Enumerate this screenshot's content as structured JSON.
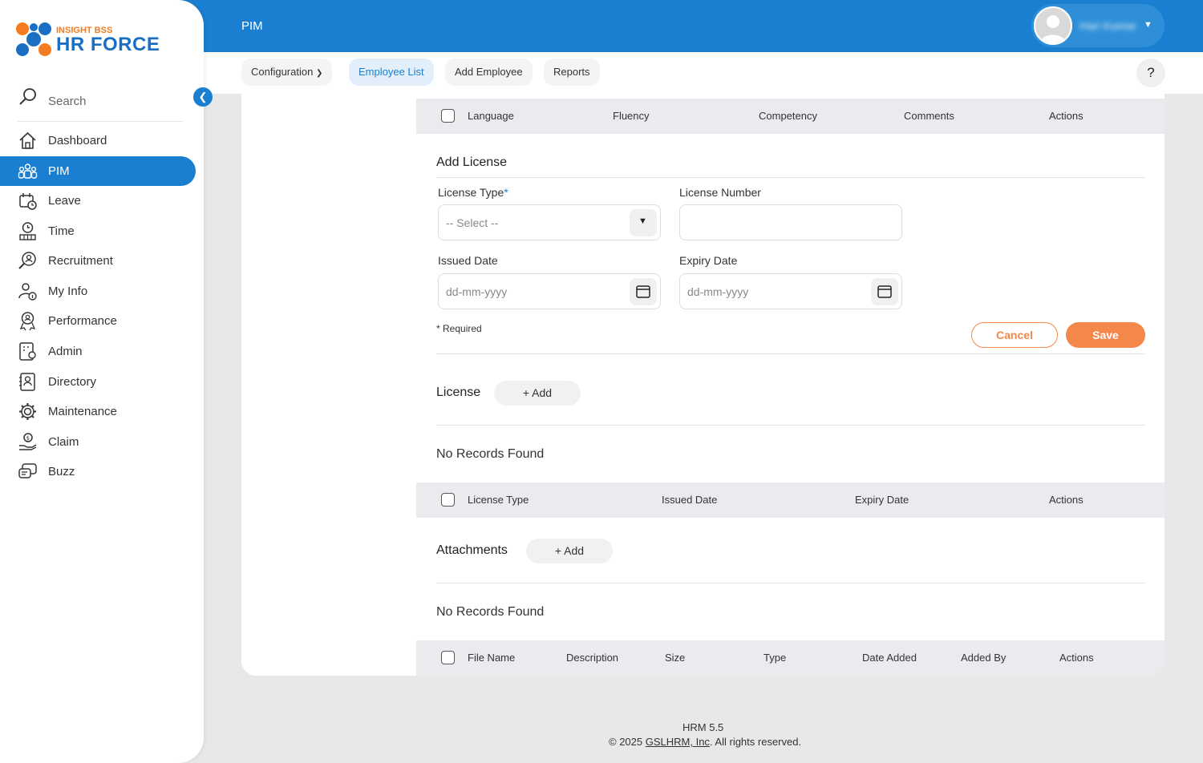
{
  "app": {
    "logo_small": "INSIGHT BSS",
    "logo_big": "HR FORCE",
    "module_title": "PIM",
    "user_name": "Hari Kumar",
    "colors": {
      "primary": "#1a7fd0",
      "accent": "#f4884a",
      "logo_orange": "#f47b20",
      "logo_blue": "#1a6fc4"
    }
  },
  "sidebar": {
    "search_label": "Search",
    "items": [
      {
        "label": "Dashboard",
        "icon": "home-icon"
      },
      {
        "label": "PIM",
        "icon": "people-icon",
        "active": true
      },
      {
        "label": "Leave",
        "icon": "leave-icon"
      },
      {
        "label": "Time",
        "icon": "clock-icon"
      },
      {
        "label": "Recruitment",
        "icon": "recruitment-icon"
      },
      {
        "label": "My Info",
        "icon": "user-info-icon"
      },
      {
        "label": "Performance",
        "icon": "award-icon"
      },
      {
        "label": "Admin",
        "icon": "admin-icon"
      },
      {
        "label": "Directory",
        "icon": "directory-icon"
      },
      {
        "label": "Maintenance",
        "icon": "gear-icon"
      },
      {
        "label": "Claim",
        "icon": "claim-icon"
      },
      {
        "label": "Buzz",
        "icon": "chat-icon"
      }
    ]
  },
  "subnav": {
    "configuration": "Configuration",
    "employee_list": "Employee List",
    "add_employee": "Add Employee",
    "reports": "Reports",
    "help": "?"
  },
  "language_table": {
    "columns": [
      "Language",
      "Fluency",
      "Competency",
      "Comments",
      "Actions"
    ]
  },
  "add_license": {
    "title": "Add License",
    "license_type_label": "License Type",
    "license_type_required": "*",
    "license_type_value": "-- Select --",
    "license_number_label": "License Number",
    "license_number_value": "",
    "issued_date_label": "Issued Date",
    "issued_date_placeholder": "dd-mm-yyyy",
    "expiry_date_label": "Expiry Date",
    "expiry_date_placeholder": "dd-mm-yyyy",
    "required_note": "* Required",
    "cancel_label": "Cancel",
    "save_label": "Save"
  },
  "license_section": {
    "title": "License",
    "add_label": "+  Add",
    "empty_text": "No Records Found",
    "columns": [
      "License Type",
      "Issued Date",
      "Expiry Date",
      "Actions"
    ]
  },
  "attachments_section": {
    "title": "Attachments",
    "add_label": "+  Add",
    "empty_text": "No Records Found",
    "columns": [
      "File Name",
      "Description",
      "Size",
      "Type",
      "Date Added",
      "Added By",
      "Actions"
    ]
  },
  "footer": {
    "version": "HRM 5.5",
    "copyright_prefix": "© 2025 ",
    "company": "GSLHRM, Inc",
    "copyright_suffix": ". All rights reserved."
  }
}
